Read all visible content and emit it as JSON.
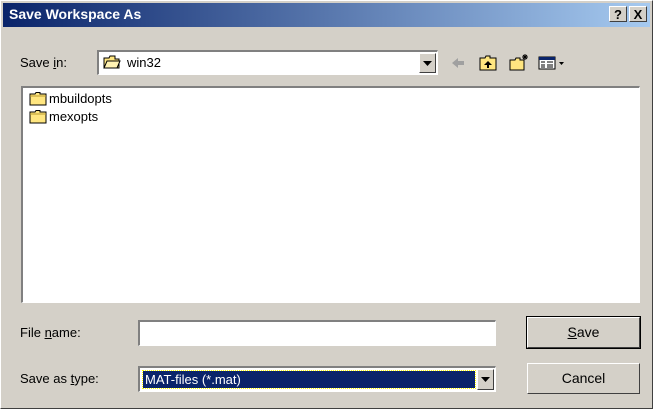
{
  "window": {
    "title": "Save Workspace As",
    "help_label": "?",
    "close_label": "X"
  },
  "save_in": {
    "label_pre": "Save ",
    "label_key": "i",
    "label_post": "n:",
    "value": "win32"
  },
  "toolbar": {
    "icons": [
      "back-arrow-icon",
      "up-folder-icon",
      "new-folder-icon",
      "view-menu-icon"
    ]
  },
  "files": [
    {
      "name": "mbuildopts",
      "icon": "folder-icon"
    },
    {
      "name": "mexopts",
      "icon": "folder-icon"
    }
  ],
  "file_name": {
    "label_pre": "File ",
    "label_key": "n",
    "label_post": "ame:",
    "value": ""
  },
  "save_as_type": {
    "label_pre": "Save as ",
    "label_key": "t",
    "label_post": "ype:",
    "value": "MAT-files (*.mat)"
  },
  "buttons": {
    "save_key": "S",
    "save_rest": "ave",
    "cancel": "Cancel"
  },
  "colors": {
    "title_gradient_start": "#0a246a",
    "title_gradient_end": "#a6caf0",
    "selection": "#0a246a",
    "face": "#d4d0c8",
    "folder_yellow": "#ffe680"
  }
}
